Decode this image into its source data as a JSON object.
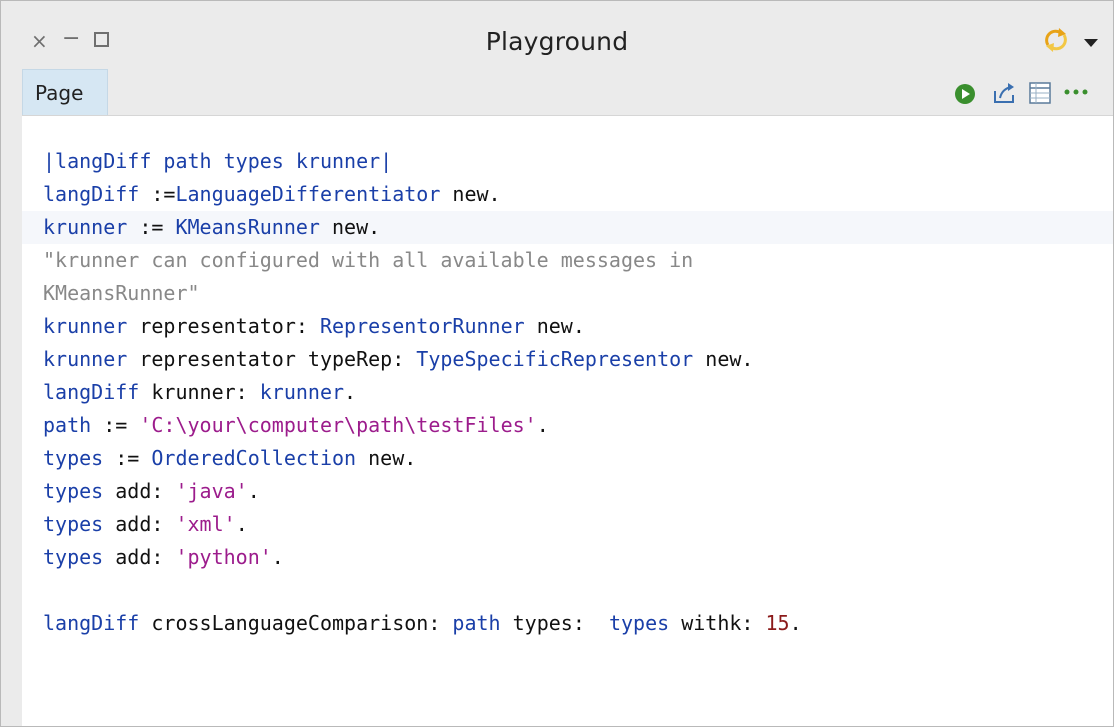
{
  "window": {
    "title": "Playground",
    "controls": {
      "close": "×",
      "minimize": "−"
    }
  },
  "tab": {
    "label": "Page"
  },
  "toolbar": {
    "icons": [
      "play-icon",
      "export-icon",
      "table-icon",
      "more-icon"
    ],
    "more_label": "···"
  },
  "colors": {
    "tab_bg": "#d6e7f3",
    "keyword": "#1a3fa8",
    "string": "#9c1c8c",
    "comment": "#888888",
    "number": "#8b1a1a",
    "run_green": "#3a8f2e"
  },
  "code": {
    "l1": {
      "a": "|langDiff path types krunner|"
    },
    "l2": {
      "a": "langDiff",
      "b": " :=",
      "c": "LanguageDifferentiator",
      "d": " new."
    },
    "l3": {
      "a": "krunner",
      "b": " := ",
      "c": "KMeansRunner",
      "d": " new."
    },
    "l4": {
      "a": "\"krunner can configured with all available messages in"
    },
    "l5": {
      "a": "KMeansRunner\""
    },
    "l6": {
      "a": "krunner",
      "b": " representator: ",
      "c": "RepresentorRunner",
      "d": " new."
    },
    "l7": {
      "a": "krunner",
      "b": " representator typeRep: ",
      "c": "TypeSpecificRepresentor",
      "d": " new."
    },
    "l8": {
      "a": "langDiff",
      "b": " krunner: ",
      "c": "krunner",
      "d": "."
    },
    "l9": {
      "a": "path",
      "b": " := ",
      "c": "'C:\\your\\computer\\path\\testFiles'",
      "d": "."
    },
    "l10": {
      "a": "types",
      "b": " := ",
      "c": "OrderedCollection",
      "d": " new."
    },
    "l11": {
      "a": "types",
      "b": " add: ",
      "c": "'java'",
      "d": "."
    },
    "l12": {
      "a": "types",
      "b": " add: ",
      "c": "'xml'",
      "d": "."
    },
    "l13": {
      "a": "types",
      "b": " add: ",
      "c": "'python'",
      "d": "."
    },
    "l15": {
      "a": "langDiff",
      "b": " crossLanguageComparison: ",
      "c": "path",
      "d": " types:  ",
      "e": "types",
      "f": " withk: ",
      "g": "15",
      "h": "."
    }
  }
}
